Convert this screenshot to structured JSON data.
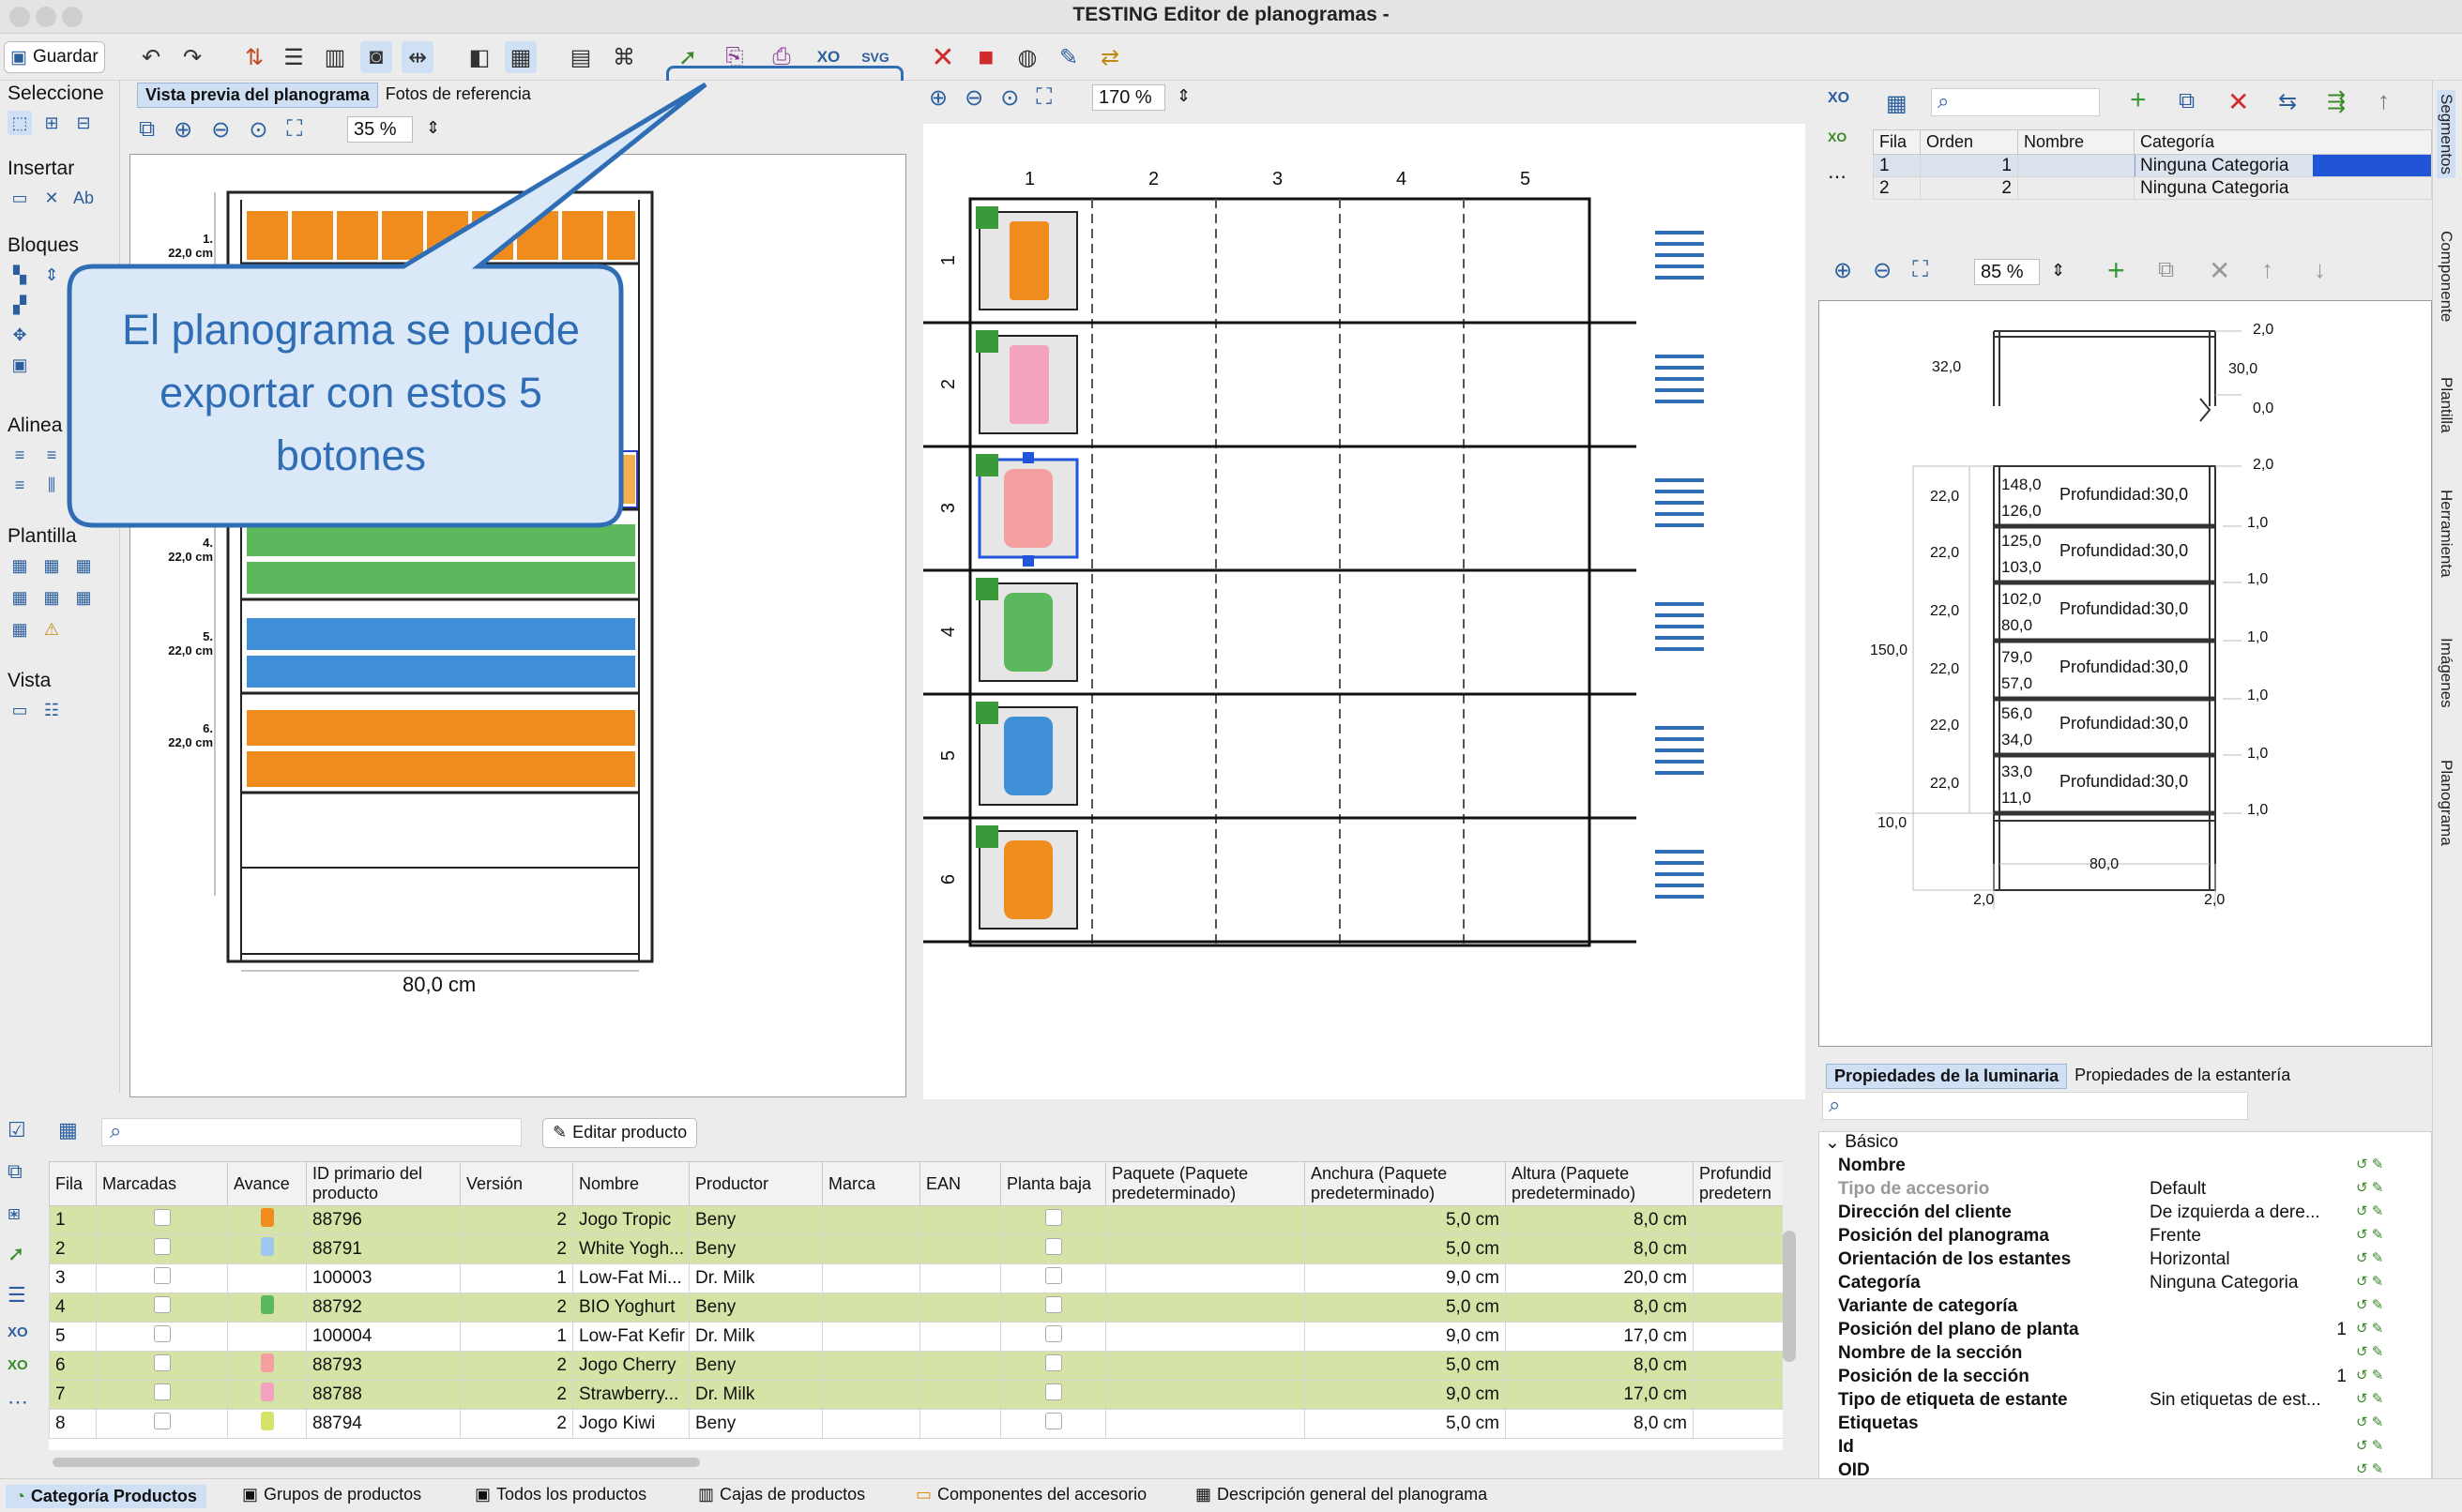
{
  "window": {
    "title": "TESTING Editor de planogramas -"
  },
  "toolbar": {
    "save_label": "Guardar"
  },
  "left_sections": [
    "Seleccione",
    "Insertar",
    "Bloques",
    "Alinea",
    "Plantilla",
    "Vista"
  ],
  "preview": {
    "tabs": [
      "Vista previa del planograma",
      "Fotos de referencia"
    ],
    "zoom": "35 %",
    "width_label": "80,0 cm",
    "shelves": [
      {
        "label": "1.",
        "height": "22,0 cm"
      },
      {
        "label": "4.",
        "height": "22,0 cm"
      },
      {
        "label": "5.",
        "height": "22,0 cm"
      },
      {
        "label": "6.",
        "height": "22,0 cm"
      }
    ]
  },
  "callout": {
    "text": "El planograma se puede exportar con estos 5 botones"
  },
  "center": {
    "zoom": "170 %",
    "columns": [
      "1",
      "2",
      "3",
      "4",
      "5"
    ],
    "rows": [
      "1",
      "2",
      "3",
      "4",
      "5",
      "6"
    ]
  },
  "segments": {
    "headers": [
      "Fila",
      "Orden",
      "Nombre",
      "Categoría"
    ],
    "rows": [
      {
        "fila": "1",
        "orden": "1",
        "nombre": "",
        "categoria": "Ninguna Categoria"
      },
      {
        "fila": "2",
        "orden": "2",
        "nombre": "",
        "categoria": "Ninguna Categoria"
      }
    ]
  },
  "diagram": {
    "zoom": "85 %",
    "top": {
      "left": "32,0",
      "right": "30,0",
      "top_right": "2,0",
      "inner_right": "0,0"
    },
    "overall_height": "150,0",
    "top_gap": "2,0",
    "shelves": [
      {
        "top": "148,0",
        "bottom": "126,0",
        "depth": "Profundidad:30,0",
        "left": "22,0",
        "right": "1,0"
      },
      {
        "top": "125,0",
        "bottom": "103,0",
        "depth": "Profundidad:30,0",
        "left": "22,0",
        "right": "1,0"
      },
      {
        "top": "102,0",
        "bottom": "80,0",
        "depth": "Profundidad:30,0",
        "left": "22,0",
        "right": "1,0"
      },
      {
        "top": "79,0",
        "bottom": "57,0",
        "depth": "Profundidad:30,0",
        "left": "22,0",
        "right": "1,0"
      },
      {
        "top": "56,0",
        "bottom": "34,0",
        "depth": "Profundidad:30,0",
        "left": "22,0",
        "right": "1,0"
      },
      {
        "top": "33,0",
        "bottom": "11,0",
        "depth": "Profundidad:30,0",
        "left": "22,0",
        "right": "1,0"
      }
    ],
    "base": "10,0",
    "width": "80,0",
    "bottom_left": "2,0",
    "bottom_right": "2,0"
  },
  "products": {
    "edit_button": "Editar producto",
    "headers": [
      "Fila",
      "Marcadas",
      "Avance",
      "ID primario del producto",
      "Versión",
      "Nombre",
      "Productor",
      "Marca",
      "EAN",
      "Planta baja",
      "Paquete (Paquete predeterminado)",
      "Anchura (Paquete predeterminado)",
      "Altura (Paquete predeterminado)",
      "Profundid predetern"
    ],
    "rows": [
      {
        "fila": "1",
        "id": "88796",
        "version": "2",
        "nombre": "Jogo Tropic",
        "productor": "Beny",
        "anchura": "5,0 cm",
        "altura": "8,0 cm",
        "hl": true
      },
      {
        "fila": "2",
        "id": "88791",
        "version": "2",
        "nombre": "White Yogh...",
        "productor": "Beny",
        "anchura": "5,0 cm",
        "altura": "8,0 cm",
        "hl": true
      },
      {
        "fila": "3",
        "id": "100003",
        "version": "1",
        "nombre": "Low-Fat Mi...",
        "productor": "Dr. Milk",
        "anchura": "9,0 cm",
        "altura": "20,0 cm",
        "hl": false
      },
      {
        "fila": "4",
        "id": "88792",
        "version": "2",
        "nombre": "BIO Yoghurt",
        "productor": "Beny",
        "anchura": "5,0 cm",
        "altura": "8,0 cm",
        "hl": true
      },
      {
        "fila": "5",
        "id": "100004",
        "version": "1",
        "nombre": "Low-Fat Kefir",
        "productor": "Dr. Milk",
        "anchura": "9,0 cm",
        "altura": "17,0 cm",
        "hl": false
      },
      {
        "fila": "6",
        "id": "88793",
        "version": "2",
        "nombre": "Jogo Cherry",
        "productor": "Beny",
        "anchura": "5,0 cm",
        "altura": "8,0 cm",
        "hl": true
      },
      {
        "fila": "7",
        "id": "88788",
        "version": "2",
        "nombre": "Strawberry...",
        "productor": "Dr. Milk",
        "anchura": "9,0 cm",
        "altura": "17,0 cm",
        "hl": true
      },
      {
        "fila": "8",
        "id": "88794",
        "version": "2",
        "nombre": "Jogo Kiwi",
        "productor": "Beny",
        "anchura": "5,0 cm",
        "altura": "8,0 cm",
        "hl": false
      }
    ]
  },
  "properties": {
    "tabs": [
      "Propiedades de la luminaria",
      "Propiedades de la estantería"
    ],
    "group": "Básico",
    "rows": [
      {
        "k": "Nombre",
        "v": ""
      },
      {
        "k": "Tipo de accesorio",
        "v": "Default"
      },
      {
        "k": "Dirección del cliente",
        "v": "De izquierda a dere..."
      },
      {
        "k": "Posición del planograma",
        "v": "Frente"
      },
      {
        "k": "Orientación de los estantes",
        "v": "Horizontal"
      },
      {
        "k": "Categoría",
        "v": "Ninguna Categoria"
      },
      {
        "k": "Variante de categoría",
        "v": ""
      },
      {
        "k": "Posición del plano de planta",
        "v": "1"
      },
      {
        "k": "Nombre de la sección",
        "v": ""
      },
      {
        "k": "Posición de la sección",
        "v": "1"
      },
      {
        "k": "Tipo de etiqueta de estante",
        "v": "Sin etiquetas de est..."
      },
      {
        "k": "Etiquetas",
        "v": ""
      },
      {
        "k": "Id",
        "v": ""
      },
      {
        "k": "OID",
        "v": ""
      }
    ]
  },
  "side_tabs": [
    "Segmentos",
    "Componente",
    "Plantilla",
    "Herramienta",
    "Imágenes",
    "Planograma"
  ],
  "bottom_tabs": [
    "Categoría Productos",
    "Grupos de productos",
    "Todos los productos",
    "Cajas de productos",
    "Componentes del accesorio",
    "Descripción general del planograma"
  ],
  "colors": {
    "accent": "#2f6db5",
    "row_highlight": "#d6e3a6",
    "select_blue": "#1f55d6"
  }
}
